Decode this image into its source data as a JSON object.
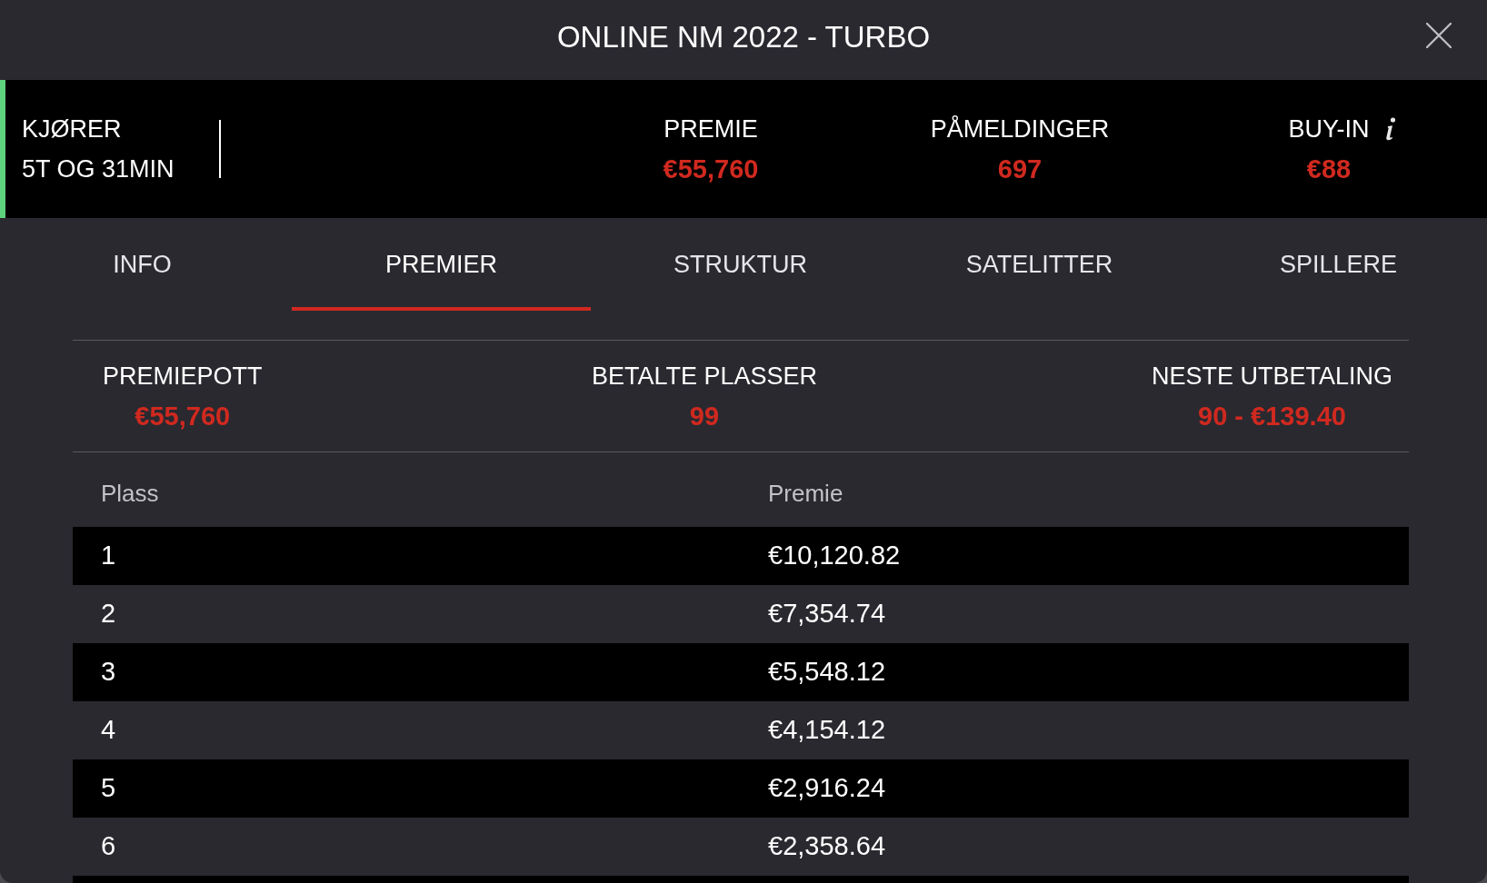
{
  "window": {
    "title": "ONLINE NM 2022 - TURBO"
  },
  "status": {
    "label": "KJØRER",
    "value": "5T OG 31MIN"
  },
  "stats": [
    {
      "label": "PREMIE",
      "value": "€55,760",
      "info": false
    },
    {
      "label": "PÅMELDINGER",
      "value": "697",
      "info": false
    },
    {
      "label": "BUY-IN",
      "value": "€88",
      "info": true
    }
  ],
  "tabs": [
    {
      "label": "INFO",
      "selected": false
    },
    {
      "label": "PREMIER",
      "selected": true
    },
    {
      "label": "STRUKTUR",
      "selected": false
    },
    {
      "label": "SATELITTER",
      "selected": false
    },
    {
      "label": "SPILLERE",
      "selected": false
    }
  ],
  "summary": [
    {
      "label": "PREMIEPOTT",
      "value": "€55,760"
    },
    {
      "label": "BETALTE PLASSER",
      "value": "99"
    },
    {
      "label": "NESTE UTBETALING",
      "value": "90 - €139.40"
    }
  ],
  "table": {
    "columns": [
      "Plass",
      "Premie"
    ],
    "rows": [
      [
        "1",
        "€10,120.82"
      ],
      [
        "2",
        "€7,354.74"
      ],
      [
        "3",
        "€5,548.12"
      ],
      [
        "4",
        "€4,154.12"
      ],
      [
        "5",
        "€2,916.24"
      ],
      [
        "6",
        "€2,358.64"
      ]
    ]
  }
}
